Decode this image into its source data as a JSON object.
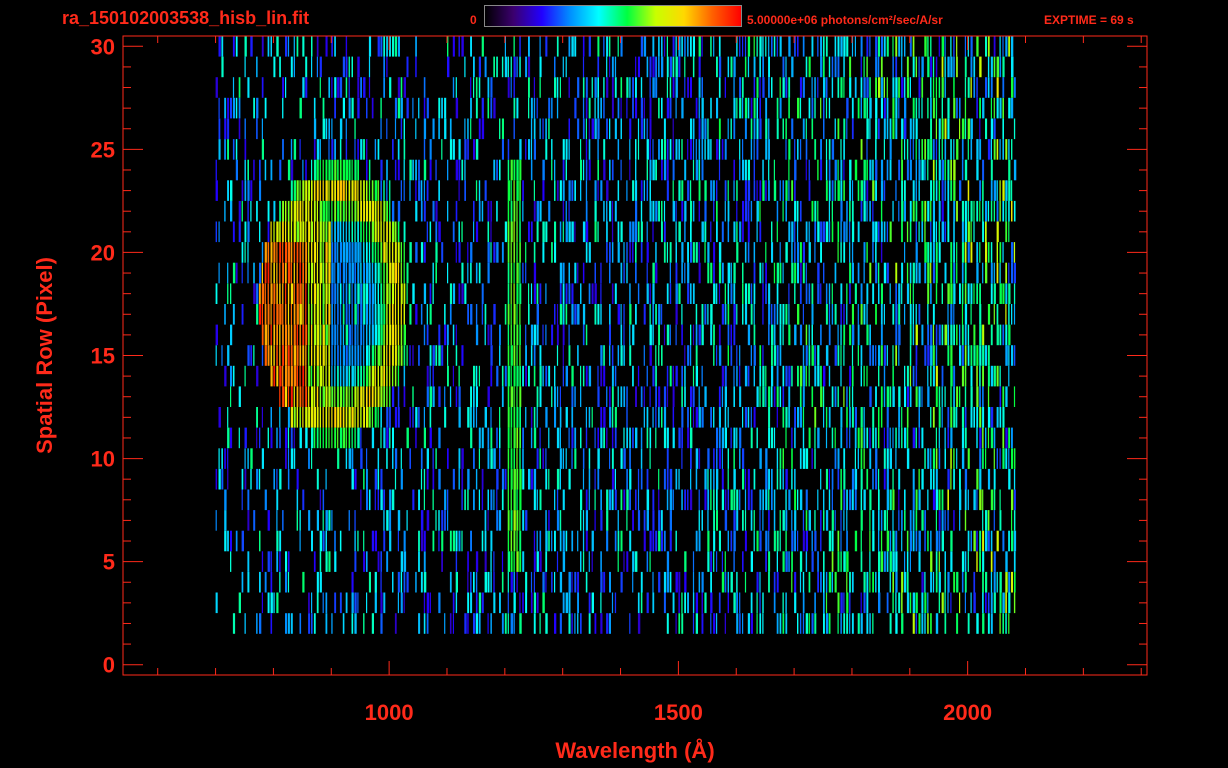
{
  "header": {
    "filename": "ra_150102003538_hisb_lin.fit",
    "colorbar_min": "0",
    "colorbar_max": "5.00000e+06 photons/cm²/sec/A/sr",
    "exptime": "EXPTIME = 69 s"
  },
  "colors": {
    "axis": "#ff2a1a",
    "background": "#000000",
    "colormap": [
      "#000000",
      "#3b006e",
      "#2200ff",
      "#0090ff",
      "#00ffff",
      "#00ff40",
      "#c8ff00",
      "#ffd800",
      "#ff6000",
      "#ff0000"
    ]
  },
  "chart_data": {
    "type": "heatmap",
    "title": "",
    "xlabel": "Wavelength (Å)",
    "ylabel": "Spatial Row (Pixel)",
    "xlim": [
      540,
      2310
    ],
    "ylim": [
      -0.5,
      30.5
    ],
    "xticks": [
      1000,
      1500,
      2000
    ],
    "yticks": [
      0,
      5,
      10,
      15,
      20,
      25,
      30
    ],
    "colorbar_range": [
      0,
      5000000
    ],
    "data_extent": {
      "wavelength_range": [
        700,
        2085
      ],
      "row_range": [
        2,
        30
      ]
    },
    "features": [
      {
        "name": "",
        "type": "arc",
        "wavelength_range": [
          780,
          1030
        ],
        "row_range": [
          11,
          24
        ],
        "peak_rows": [
          13,
          20
        ],
        "level": 1.0
      },
      {
        "name": "",
        "type": "line",
        "wavelength": 1216,
        "row_range": [
          5,
          24
        ],
        "level": 0.55
      }
    ]
  }
}
